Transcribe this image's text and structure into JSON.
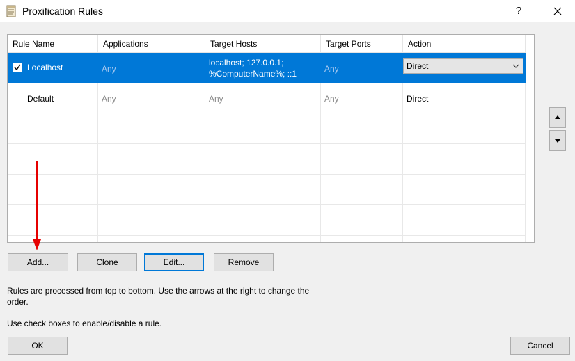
{
  "window": {
    "title": "Proxification Rules",
    "help_label": "?"
  },
  "table": {
    "columns": [
      "Rule Name",
      "Applications",
      "Target Hosts",
      "Target Ports",
      "Action"
    ],
    "rows": [
      {
        "name": "Localhost",
        "checked": true,
        "selected": true,
        "applications": "Any",
        "hosts_line1": "localhost; 127.0.0.1;",
        "hosts_line2": "%ComputerName%; ::1",
        "ports": "Any",
        "action": "Direct"
      },
      {
        "name": "Default",
        "checked": false,
        "selected": false,
        "applications": "Any",
        "hosts": "Any",
        "ports": "Any",
        "action": "Direct"
      }
    ]
  },
  "buttons": {
    "add": "Add...",
    "clone": "Clone",
    "edit": "Edit...",
    "remove": "Remove",
    "ok": "OK",
    "cancel": "Cancel"
  },
  "info": {
    "line1": "Rules are processed from top to bottom. Use the arrows at the right to change the",
    "line2": "order.",
    "line3": "Use check boxes to enable/disable a rule."
  },
  "colors": {
    "selection": "#0078d7",
    "annotation_arrow": "#e60000"
  },
  "icons": [
    "app-icon",
    "close-icon",
    "checkbox-check-icon",
    "chevron-down-icon",
    "move-up-icon",
    "move-down-icon",
    "annotation-arrow"
  ]
}
